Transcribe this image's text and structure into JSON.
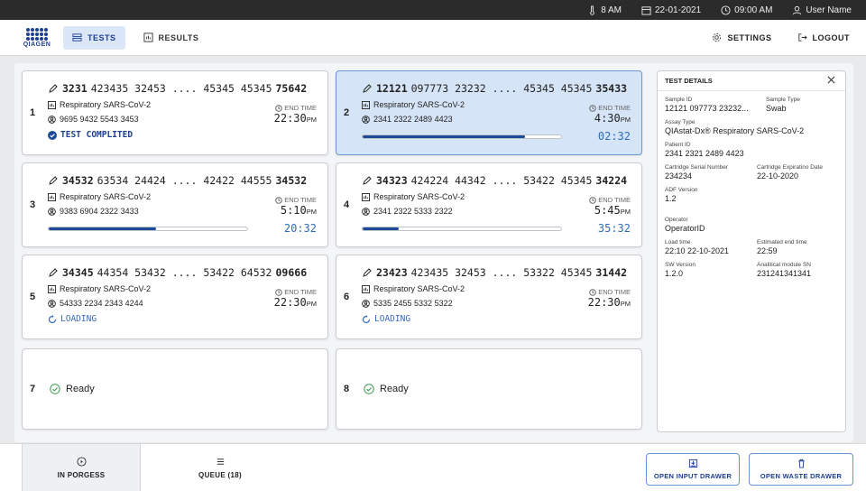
{
  "status_bar": {
    "temp": "8 AM",
    "date": "22-01-2021",
    "time": "09:00 AM",
    "user": "User Name"
  },
  "nav": {
    "logo_text": "QIAGEN",
    "tests_label": "TESTS",
    "results_label": "RESULTS",
    "settings_label": "SETTINGS",
    "logout_label": "LOGOUT"
  },
  "cards": [
    {
      "num": "1",
      "id_prefix": "3231",
      "id_mid": "423435 32453 .... 45345 45345",
      "id_suffix": "75642",
      "assay": "Respiratory SARS-CoV-2",
      "patient": "9695 9432 5543 3453",
      "end_label": "END TIME",
      "end_time": "22:30",
      "end_ampm": "PM",
      "status": "TEST COMPLITED"
    },
    {
      "num": "2",
      "id_prefix": "12121",
      "id_mid": "097773 23232 .... 45345 45345",
      "id_suffix": "35433",
      "assay": "Respiratory SARS-CoV-2",
      "patient": "2341 2322 2489 4423",
      "end_label": "END TIME",
      "end_time": "4:30",
      "end_ampm": "PM",
      "remaining": "02:32",
      "progress": 0.82
    },
    {
      "num": "3",
      "id_prefix": "34532",
      "id_mid": "63534 24424 .... 42422 44555",
      "id_suffix": "34532",
      "assay": "Respiratory SARS-CoV-2",
      "patient": "9383 6904 2322 3433",
      "end_label": "END TIME",
      "end_time": "5:10",
      "end_ampm": "PM",
      "remaining": "20:32",
      "progress": 0.54
    },
    {
      "num": "4",
      "id_prefix": "34323",
      "id_mid": "424224 44342 .... 53422 45345",
      "id_suffix": "34224",
      "assay": "Respiratory SARS-CoV-2",
      "patient": "2341 2322 5333 2322",
      "end_label": "END TIME",
      "end_time": "5:45",
      "end_ampm": "PM",
      "remaining": "35:32",
      "progress": 0.18
    },
    {
      "num": "5",
      "id_prefix": "34345",
      "id_mid": "44354 53432 .... 53422 64532",
      "id_suffix": "09666",
      "assay": "Respiratory SARS-CoV-2",
      "patient": "54333 2234 2343 4244",
      "end_label": "END TIME",
      "end_time": "22:30",
      "end_ampm": "PM",
      "status": "LOADING"
    },
    {
      "num": "6",
      "id_prefix": "23423",
      "id_mid": "423435 32453 .... 53322 45345",
      "id_suffix": "31442",
      "assay": "Respiratory SARS-CoV-2",
      "patient": "5335 2455 5332 5322",
      "end_label": "END TIME",
      "end_time": "22:30",
      "end_ampm": "PM",
      "status": "LOADING"
    },
    {
      "num": "7",
      "ready": "Ready"
    },
    {
      "num": "8",
      "ready": "Ready"
    }
  ],
  "details": {
    "title": "TEST DETAILS",
    "sample_id_k": "Sample ID",
    "sample_id_v": "12121 097773 23232...",
    "sample_type_k": "Sample Type",
    "sample_type_v": "Swab",
    "assay_type_k": "Assay Type",
    "assay_type_v": "QIAstat-Dx® Respiratory SARS-CoV-2",
    "patient_id_k": "Patient ID",
    "patient_id_v": "2341 2321 2489 4423",
    "cartridge_sn_k": "Cartridge Serial Number",
    "cartridge_sn_v": "234234",
    "cartridge_exp_k": "Cartridge Expiratino Date",
    "cartridge_exp_v": "22-10-2020",
    "adf_k": "ADF Version",
    "adf_v": "1.2",
    "operator_k": "Operator",
    "operator_v": "OperatorID",
    "load_time_k": "Load time",
    "load_time_v": "22:10 22-10-2021",
    "est_end_k": "Estimated end time",
    "est_end_v": "22:59",
    "sw_k": "SW Version",
    "sw_v": "1.2.0",
    "module_sn_k": "Analitical module SN",
    "module_sn_v": "231241341341"
  },
  "bottom": {
    "in_progress_label": "IN PORGESS",
    "queue_label": "QUEUE (18)",
    "open_input_label": "OPEN INPUT DRAWER",
    "open_waste_label": "OPEN WASTE DRAWER"
  }
}
